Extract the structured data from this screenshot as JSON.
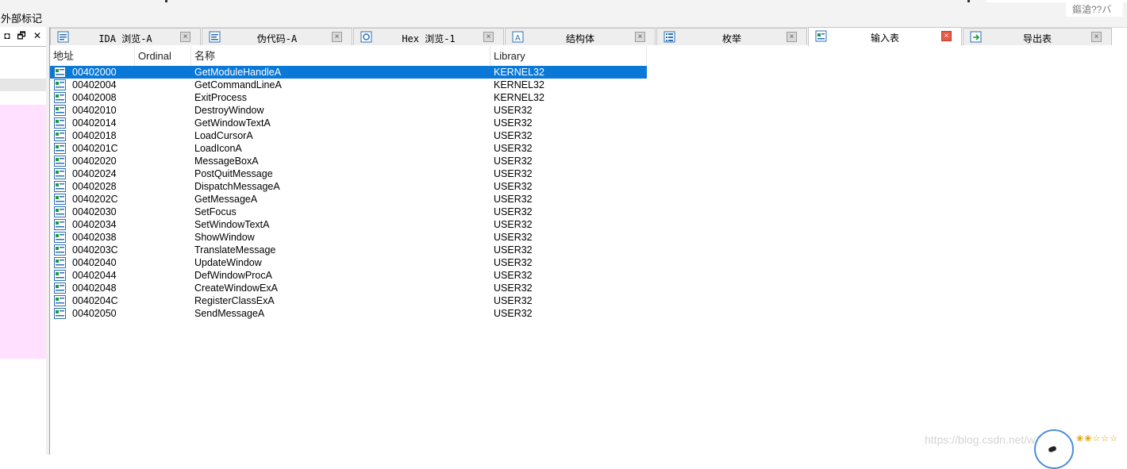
{
  "window": {
    "page_title": "外部标记",
    "corner_text": "鏂滄??バ"
  },
  "left_pane": {
    "controls": [
      "◘",
      "🗗",
      "✕"
    ]
  },
  "tabs": [
    {
      "label": "IDA 浏览-A",
      "icon": "ida-view-icon",
      "active": false
    },
    {
      "label": "伪代码-A",
      "icon": "pseudocode-icon",
      "active": false
    },
    {
      "label": "Hex 浏览-1",
      "icon": "hex-view-icon",
      "active": false
    },
    {
      "label": "结构体",
      "icon": "structures-icon",
      "active": false
    },
    {
      "label": "枚举",
      "icon": "enums-icon",
      "active": false
    },
    {
      "label": "输入表",
      "icon": "imports-icon",
      "active": true
    },
    {
      "label": "导出表",
      "icon": "exports-icon",
      "active": false
    }
  ],
  "table": {
    "columns": [
      "地址",
      "Ordinal",
      "名称",
      "Library"
    ],
    "rows": [
      {
        "address": "00402000",
        "ordinal": "",
        "name": "GetModuleHandleA",
        "library": "KERNEL32",
        "selected": true
      },
      {
        "address": "00402004",
        "ordinal": "",
        "name": "GetCommandLineA",
        "library": "KERNEL32"
      },
      {
        "address": "00402008",
        "ordinal": "",
        "name": "ExitProcess",
        "library": "KERNEL32"
      },
      {
        "address": "00402010",
        "ordinal": "",
        "name": "DestroyWindow",
        "library": "USER32"
      },
      {
        "address": "00402014",
        "ordinal": "",
        "name": "GetWindowTextA",
        "library": "USER32"
      },
      {
        "address": "00402018",
        "ordinal": "",
        "name": "LoadCursorA",
        "library": "USER32"
      },
      {
        "address": "0040201C",
        "ordinal": "",
        "name": "LoadIconA",
        "library": "USER32"
      },
      {
        "address": "00402020",
        "ordinal": "",
        "name": "MessageBoxA",
        "library": "USER32"
      },
      {
        "address": "00402024",
        "ordinal": "",
        "name": "PostQuitMessage",
        "library": "USER32"
      },
      {
        "address": "00402028",
        "ordinal": "",
        "name": "DispatchMessageA",
        "library": "USER32"
      },
      {
        "address": "0040202C",
        "ordinal": "",
        "name": "GetMessageA",
        "library": "USER32"
      },
      {
        "address": "00402030",
        "ordinal": "",
        "name": "SetFocus",
        "library": "USER32"
      },
      {
        "address": "00402034",
        "ordinal": "",
        "name": "SetWindowTextA",
        "library": "USER32"
      },
      {
        "address": "00402038",
        "ordinal": "",
        "name": "ShowWindow",
        "library": "USER32"
      },
      {
        "address": "0040203C",
        "ordinal": "",
        "name": "TranslateMessage",
        "library": "USER32"
      },
      {
        "address": "00402040",
        "ordinal": "",
        "name": "UpdateWindow",
        "library": "USER32"
      },
      {
        "address": "00402044",
        "ordinal": "",
        "name": "DefWindowProcA",
        "library": "USER32"
      },
      {
        "address": "00402048",
        "ordinal": "",
        "name": "CreateWindowExA",
        "library": "USER32"
      },
      {
        "address": "0040204C",
        "ordinal": "",
        "name": "RegisterClassExA",
        "library": "USER32"
      },
      {
        "address": "00402050",
        "ordinal": "",
        "name": "SendMessageA",
        "library": "USER32"
      }
    ]
  },
  "watermark": "https://blog.csdn.net/w1359",
  "colors": {
    "selection": "#0a78d7",
    "left_pane_highlight": "#ffe0ff",
    "active_close": "#e55b4a"
  }
}
